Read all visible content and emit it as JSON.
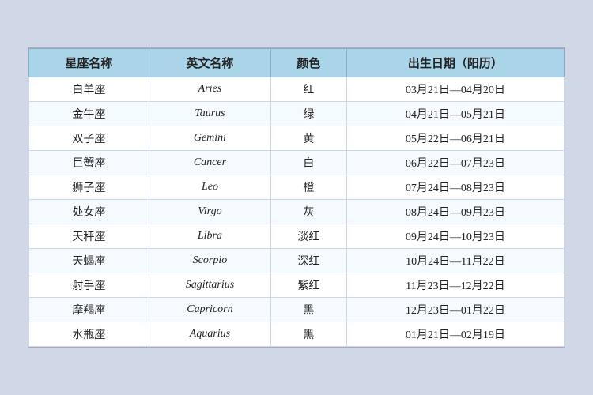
{
  "table": {
    "headers": [
      "星座名称",
      "英文名称",
      "颜色",
      "出生日期（阳历）"
    ],
    "rows": [
      {
        "chinese": "白羊座",
        "english": "Aries",
        "color": "红",
        "date": "03月21日—04月20日"
      },
      {
        "chinese": "金牛座",
        "english": "Taurus",
        "color": "绿",
        "date": "04月21日—05月21日"
      },
      {
        "chinese": "双子座",
        "english": "Gemini",
        "color": "黄",
        "date": "05月22日—06月21日"
      },
      {
        "chinese": "巨蟹座",
        "english": "Cancer",
        "color": "白",
        "date": "06月22日—07月23日"
      },
      {
        "chinese": "狮子座",
        "english": "Leo",
        "color": "橙",
        "date": "07月24日—08月23日"
      },
      {
        "chinese": "处女座",
        "english": "Virgo",
        "color": "灰",
        "date": "08月24日—09月23日"
      },
      {
        "chinese": "天秤座",
        "english": "Libra",
        "color": "淡红",
        "date": "09月24日—10月23日"
      },
      {
        "chinese": "天蝎座",
        "english": "Scorpio",
        "color": "深红",
        "date": "10月24日—11月22日"
      },
      {
        "chinese": "射手座",
        "english": "Sagittarius",
        "color": "紫红",
        "date": "11月23日—12月22日"
      },
      {
        "chinese": "摩羯座",
        "english": "Capricorn",
        "color": "黑",
        "date": "12月23日—01月22日"
      },
      {
        "chinese": "水瓶座",
        "english": "Aquarius",
        "color": "黑",
        "date": "01月21日—02月19日"
      }
    ]
  }
}
